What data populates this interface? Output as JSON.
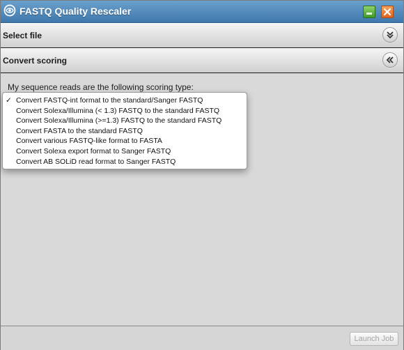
{
  "window": {
    "title": "FASTQ Quality Rescaler"
  },
  "sections": {
    "select_file": {
      "label": "Select file",
      "state": "collapsed"
    },
    "convert_scoring": {
      "label": "Convert scoring",
      "state": "expanded"
    }
  },
  "form": {
    "prompt": "My sequence reads are the following scoring type:",
    "selected_index": 0,
    "check_mark": "✓",
    "options": [
      "Convert FASTQ-int format to the standard/Sanger FASTQ",
      "Convert Solexa/Illumina (< 1.3) FASTQ to the standard FASTQ",
      "Convert Solexa/Illumina (>=1.3) FASTQ to the standard FASTQ",
      "Convert FASTA to the standard FASTQ",
      "Convert various FASTQ-like format to FASTA",
      "Convert Solexa export format to Sanger FASTQ",
      "Convert AB SOLiD read format to Sanger FASTQ"
    ]
  },
  "footer": {
    "launch_label": "Launch Job",
    "launch_enabled": false
  },
  "colors": {
    "titlebar_top": "#6aa0cc",
    "titlebar_bottom": "#3f78ad",
    "minimize": "#4caf33",
    "close": "#e8702a",
    "background": "#d9d9d9"
  },
  "icons": {
    "app": "app-logo-icon",
    "minimize": "minimize-icon",
    "close": "close-icon",
    "select_file_toggle": "chevron-double-down-icon",
    "convert_toggle": "chevron-double-left-icon"
  }
}
